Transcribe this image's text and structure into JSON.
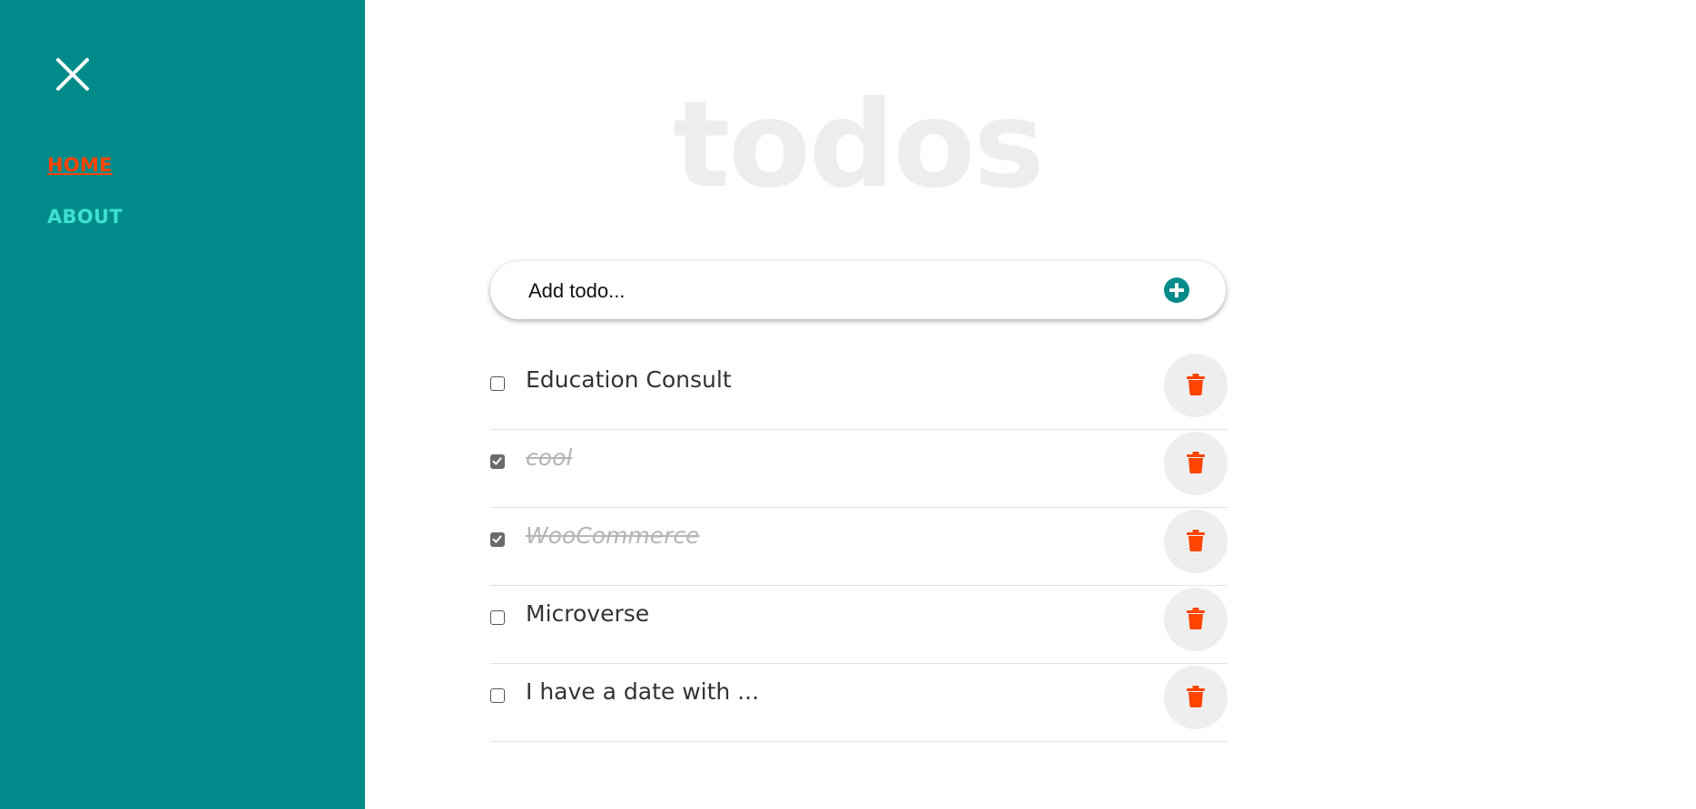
{
  "sidebar": {
    "close_icon": "close-icon",
    "nav": [
      {
        "label": "HOME",
        "active": true
      },
      {
        "label": "ABOUT",
        "active": false
      }
    ]
  },
  "main": {
    "title": "todos",
    "add_input": {
      "placeholder": "Add todo...",
      "value": ""
    },
    "add_icon": "plus-circle-icon",
    "todos": [
      {
        "text": "Education Consult",
        "completed": false
      },
      {
        "text": "cool",
        "completed": true
      },
      {
        "text": "WooCommerce",
        "completed": true
      },
      {
        "text": "Microverse",
        "completed": false
      },
      {
        "text": "I have a date with ...",
        "completed": false
      }
    ],
    "delete_icon": "trash-icon"
  },
  "colors": {
    "sidebar_bg": "#008b8b",
    "active_link": "#ff4500",
    "inactive_link": "#40e0d0",
    "accent": "#008b8b",
    "delete": "#ff4500",
    "title": "#ededed"
  }
}
